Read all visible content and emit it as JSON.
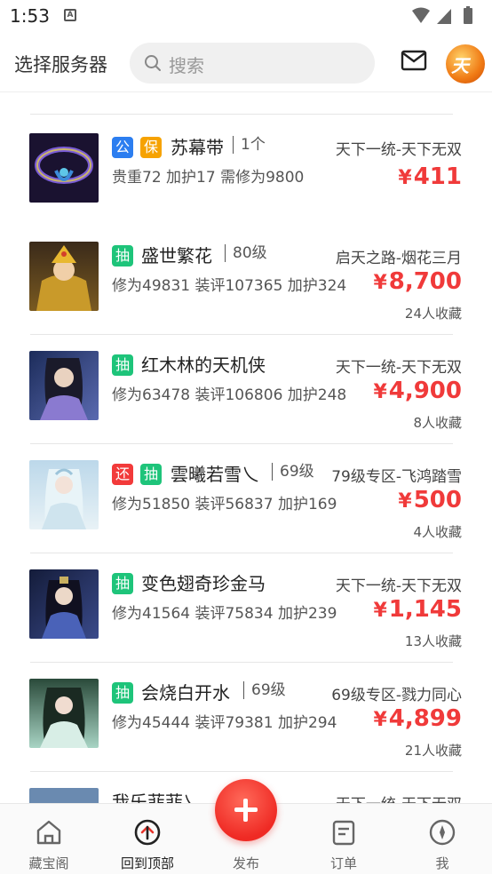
{
  "status_bar": {
    "time": "1:53"
  },
  "header": {
    "title": "选择服务器",
    "search_placeholder": "搜索"
  },
  "listings": [
    {
      "tags": [
        {
          "text": "公",
          "kind": "gong"
        },
        {
          "text": "保",
          "kind": "bao"
        }
      ],
      "name": "苏幕带",
      "level": "1个",
      "server": "天下一统-天下无双",
      "attrs": "贵重72 加护17 需修为9800",
      "price": "411",
      "favorites": ""
    },
    {
      "tags": [
        {
          "text": "抽",
          "kind": "chou"
        }
      ],
      "name": "盛世繁花",
      "level": "80级",
      "server": "启天之路-烟花三月",
      "attrs": "修为49831 装评107365 加护324",
      "price": "8,700",
      "favorites": "24人收藏"
    },
    {
      "tags": [
        {
          "text": "抽",
          "kind": "chou"
        }
      ],
      "name": "红木林的天机侠",
      "level": "",
      "server": "天下一统-天下无双",
      "attrs": "修为63478 装评106806 加护248",
      "price": "4,900",
      "favorites": "8人收藏"
    },
    {
      "tags": [
        {
          "text": "还",
          "kind": "huan"
        },
        {
          "text": "抽",
          "kind": "chou"
        }
      ],
      "name": "雲曦若雪乀",
      "level": "69级",
      "server": "79级专区-飞鸿踏雪",
      "attrs": "修为51850 装评56837 加护169",
      "price": "500",
      "favorites": "4人收藏"
    },
    {
      "tags": [
        {
          "text": "抽",
          "kind": "chou"
        }
      ],
      "name": "变色翅奇珍金马",
      "level": "",
      "server": "天下一统-天下无双",
      "attrs": "修为41564 装评75834 加护239",
      "price": "1,145",
      "favorites": "13人收藏"
    },
    {
      "tags": [
        {
          "text": "抽",
          "kind": "chou"
        }
      ],
      "name": "会烧白开水",
      "level": "69级",
      "server": "69级专区-戮力同心",
      "attrs": "修为45444 装评79381 加护294",
      "price": "4,899",
      "favorites": "21人收藏"
    },
    {
      "tags": [],
      "name": "我乐菲菲乀",
      "level": "",
      "server": "天下一统-天下无双",
      "attrs": "",
      "price": "",
      "favorites": ""
    }
  ],
  "currency_symbol": "¥",
  "tabbar": {
    "home": "藏宝阁",
    "top": "回到顶部",
    "publish": "发布",
    "orders": "订单",
    "me": "我"
  },
  "colors": {
    "accent_red": "#f03a3a",
    "tag_gong": "#2c7ef0",
    "tag_bao": "#f6a200",
    "tag_chou": "#1ec47a",
    "tag_huan": "#f23a3a"
  }
}
